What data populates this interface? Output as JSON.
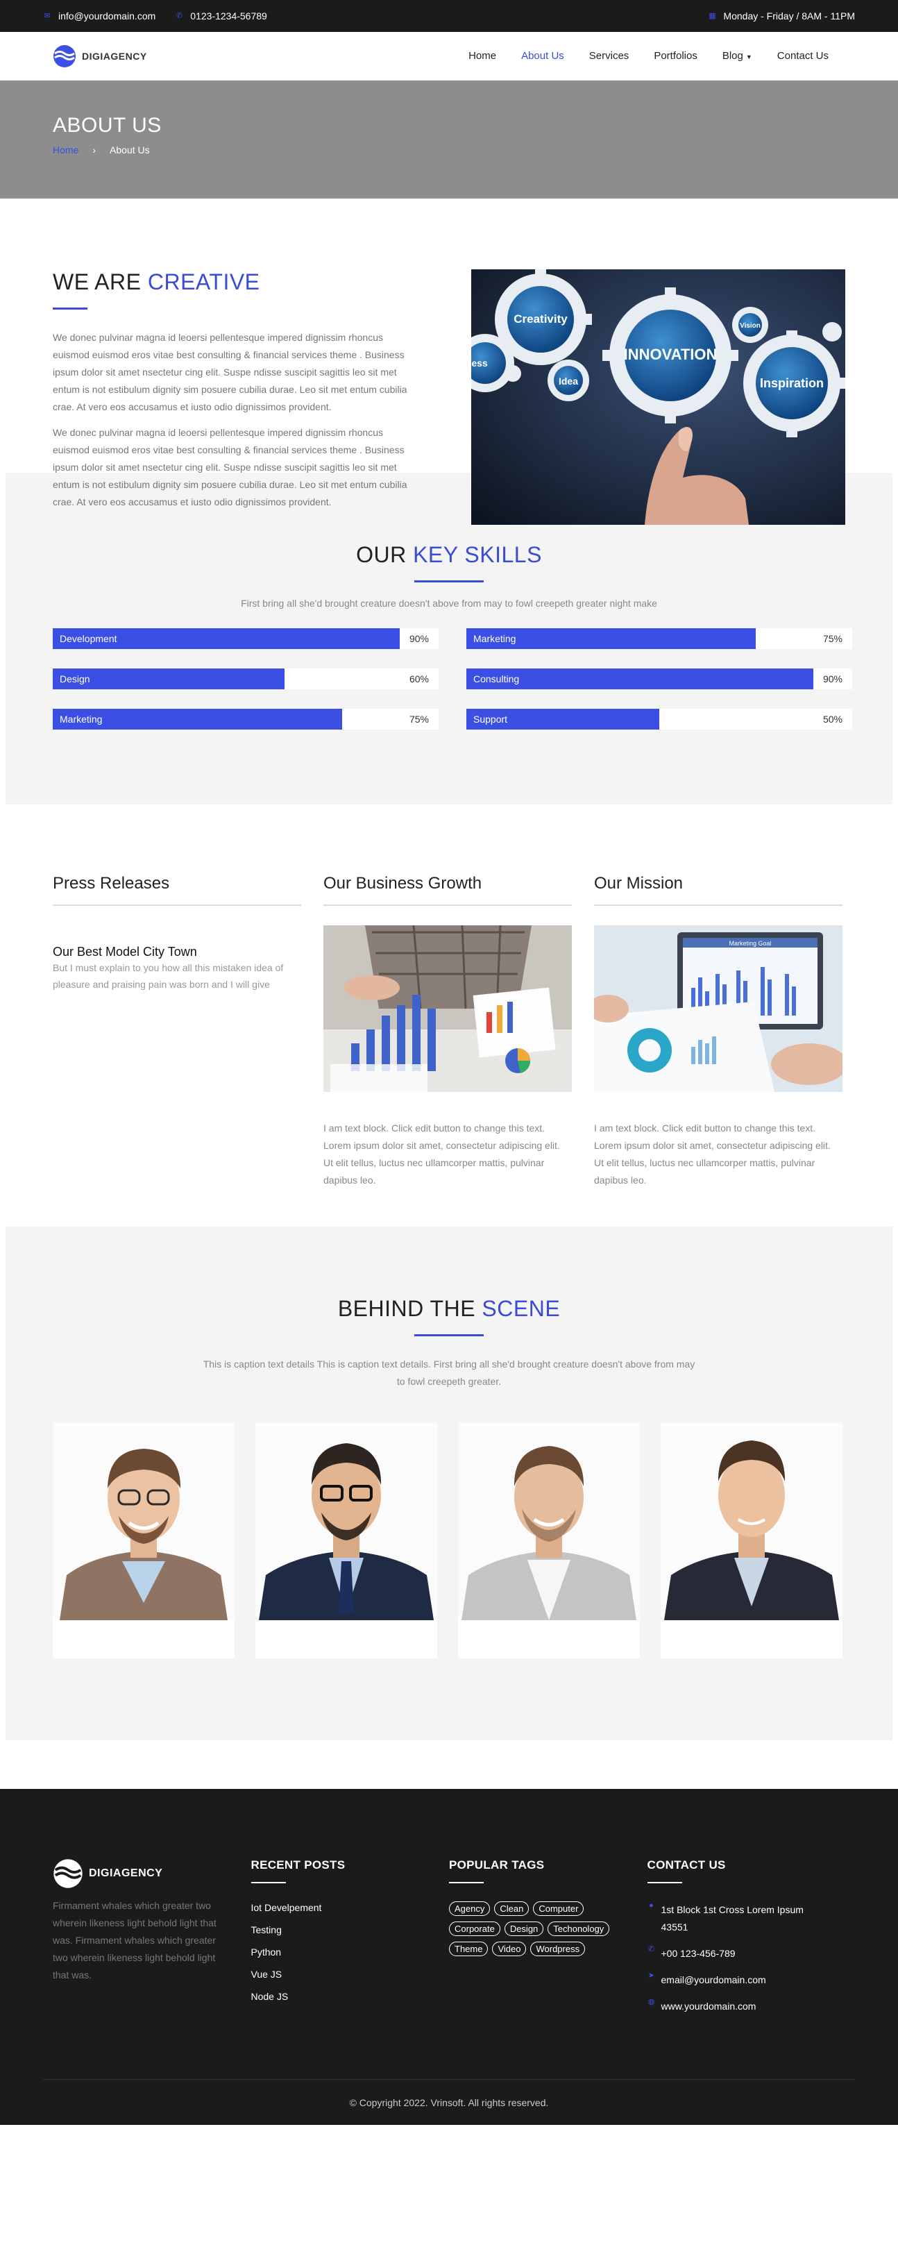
{
  "topbar": {
    "email": "info@yourdomain.com",
    "phone": "0123-1234-56789",
    "hours": "Monday - Friday / 8AM - 11PM"
  },
  "brand": {
    "name": "DIGIAGENCY"
  },
  "nav": [
    {
      "label": "Home"
    },
    {
      "label": "About Us",
      "active": true
    },
    {
      "label": "Services"
    },
    {
      "label": "Portfolios"
    },
    {
      "label": "Blog"
    },
    {
      "label": "Contact Us"
    }
  ],
  "banner": {
    "title": "ABOUT US",
    "crumb_home": "Home",
    "crumb_current": "About Us"
  },
  "about": {
    "title_plain": "WE ARE ",
    "title_accent": "CREATIVE",
    "p1": "We donec pulvinar magna id leoersi pellentesque impered dignissim rhoncus euismod euismod eros vitae best consulting & financial services theme . Business ipsum dolor sit amet nsectetur cing elit. Suspe ndisse suscipit sagittis leo sit met entum is not estibulum dignity sim posuere cubilia durae. Leo sit met entum cubilia crae. At vero eos accusamus et iusto odio dignissimos provident.",
    "p2": "We donec pulvinar magna id leoersi pellentesque impered dignissim rhoncus euismod euismod eros vitae best consulting & financial services theme . Business ipsum dolor sit amet nsectetur cing elit. Suspe ndisse suscipit sagittis leo sit met entum is not estibulum dignity sim posuere cubilia durae. Leo sit met entum cubilia crae. At vero eos accusamus et iusto odio dignissimos provident.",
    "image_words": [
      "Creativity",
      "INNOVATION",
      "Inspiration",
      "Idea",
      "Vision",
      "ess"
    ]
  },
  "skills": {
    "title_plain": "OUR ",
    "title_accent": "KEY SKILLS",
    "subtitle": "First bring all she'd brought creature doesn't above from may to fowl creepeth greater night make",
    "items": [
      {
        "label": "Development",
        "pct_label": "90%",
        "value": 0.9
      },
      {
        "label": "Marketing",
        "pct_label": "75%",
        "value": 0.75
      },
      {
        "label": "Design",
        "pct_label": "60%",
        "value": 0.6
      },
      {
        "label": "Consulting",
        "pct_label": "90%",
        "value": 0.9
      },
      {
        "label": "Marketing",
        "pct_label": "75%",
        "value": 0.75
      },
      {
        "label": "Support",
        "pct_label": "50%",
        "value": 0.5
      }
    ]
  },
  "press": {
    "title": "Press Releases",
    "item_title": "Our Best Model City Town",
    "item_text": "But I must explain to you how all this mistaken idea of pleasure and praising pain was born and I will give"
  },
  "growth": {
    "title": "Our Business Growth",
    "text": "I am text block. Click edit button to change this text. Lorem ipsum dolor sit amet, consectetur adipiscing elit. Ut elit tellus, luctus nec ullamcorper mattis, pulvinar dapibus leo."
  },
  "mission": {
    "title": "Our Mission",
    "text": "I am text block. Click edit button to change this text. Lorem ipsum dolor sit amet, consectetur adipiscing elit. Ut elit tellus, luctus nec ullamcorper mattis, pulvinar dapibus leo.",
    "screen_label": "Marketing Goal"
  },
  "team": {
    "title_plain": "BEHIND THE ",
    "title_accent": "SCENE",
    "subtitle": "This is caption text details This is caption text details. First bring all she'd brought creature doesn't above from may to fowl creepeth greater."
  },
  "footer": {
    "brand": "DIGIAGENCY",
    "desc": "Firmament whales which greater two wherein likeness light behold light that was. Firmament whales which greater two wherein likeness light behold light that was.",
    "recent_title": "RECENT POSTS",
    "posts": [
      "Iot Develpement",
      "Testing",
      "Python",
      "Vue JS",
      "Node JS"
    ],
    "tags_title": "POPULAR TAGS",
    "tags": [
      "Agency",
      "Clean",
      "Computer",
      "Corporate",
      "Design",
      "Techonology",
      "Theme",
      "Video",
      "Wordpress"
    ],
    "contact_title": "CONTACT US",
    "address": "1st Block 1st Cross Lorem Ipsum 43551",
    "phone": "+00 123-456-789",
    "email": "email@yourdomain.com",
    "web": "www.yourdomain.com",
    "copyright": "© Copyright 2022. Vrinsoft. All rights reserved."
  },
  "colors": {
    "accent": "#3b4fe4",
    "dark": "#1b1b1b",
    "banner": "#8d8d8d",
    "section_bg": "#f4f4f4"
  }
}
